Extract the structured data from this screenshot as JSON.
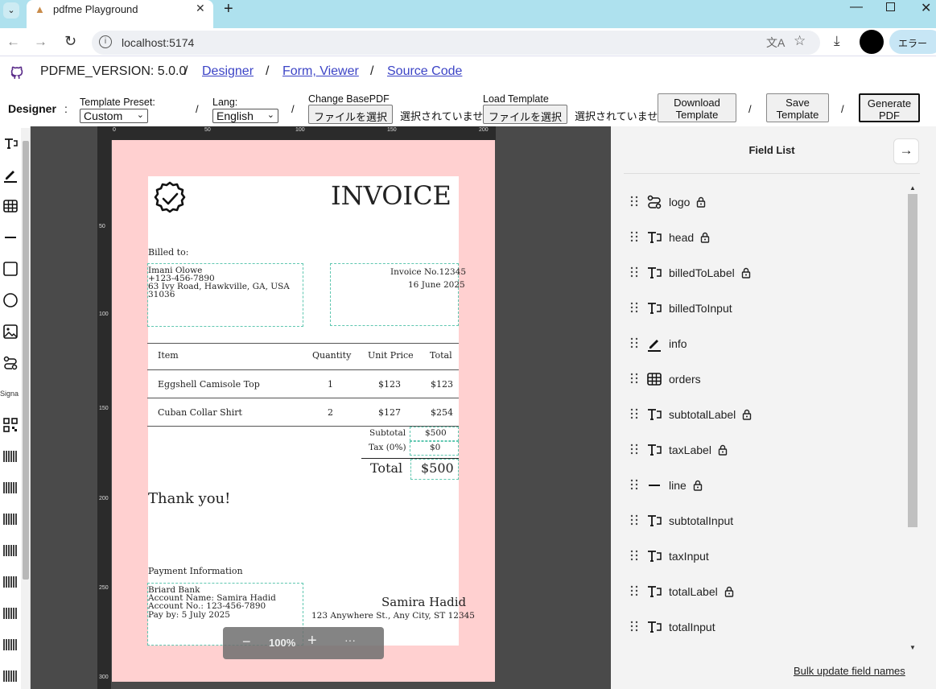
{
  "browser": {
    "tab_title": "pdfme Playground",
    "url": "localhost:5174",
    "error_label": "エラー"
  },
  "header": {
    "version": "PDFME_VERSION: 5.0.0",
    "links": [
      "Designer",
      "Form, Viewer",
      "Source Code"
    ],
    "separator": "/"
  },
  "toolbar": {
    "mode": "Designer",
    "colon": ":",
    "template_preset_label": "Template Preset:",
    "template_preset_value": "Custom",
    "lang_label": "Lang:",
    "lang_value": "English",
    "change_basepdf_label": "Change BasePDF",
    "load_template_label": "Load Template",
    "file_button": "ファイルを選択",
    "file_none": "選択されていません",
    "download_label": "Download Template",
    "save_label": "Save Template",
    "generate_label": "Generate PDF",
    "sep": "/"
  },
  "palette": {
    "signature_label": "Signa"
  },
  "ruler": {
    "top": [
      "0",
      "50",
      "100",
      "150",
      "200"
    ],
    "left": [
      "50",
      "100",
      "150",
      "200",
      "250",
      "300"
    ]
  },
  "invoice": {
    "title": "INVOICE",
    "billed_to_label": "Billed to:",
    "billed_to": [
      "Imani Olowe",
      "+123-456-7890",
      "63 Ivy Road, Hawkville, GA, USA",
      "31036"
    ],
    "info": [
      "Invoice No.12345",
      "16 June 2025"
    ],
    "orders_header": [
      "Item",
      "Quantity",
      "Unit Price",
      "Total"
    ],
    "orders": [
      [
        "Eggshell Camisole Top",
        "1",
        "$123",
        "$123"
      ],
      [
        "Cuban Collar Shirt",
        "2",
        "$127",
        "$254"
      ]
    ],
    "subtotal_label": "Subtotal",
    "subtotal": "$500",
    "tax_label": "Tax (0%)",
    "tax": "$0",
    "total_label": "Total",
    "total": "$500",
    "thank_you": "Thank you!",
    "payment_label": "Payment Information",
    "payment": [
      "Briard Bank",
      "Account Name: Samira Hadid",
      "Account No.: 123-456-7890",
      "Pay by: 5 July 2025"
    ],
    "shop_name": "Samira Hadid",
    "shop_address": "123 Anywhere St., Any City, ST 12345"
  },
  "zoom": {
    "minus": "−",
    "value": "100%",
    "plus": "+",
    "more": "···"
  },
  "field_list": {
    "title": "Field List",
    "items": [
      {
        "name": "logo",
        "icon": "image-icon",
        "locked": true
      },
      {
        "name": "head",
        "icon": "text-icon",
        "locked": true
      },
      {
        "name": "billedToLabel",
        "icon": "text-icon",
        "locked": true
      },
      {
        "name": "billedToInput",
        "icon": "text-icon",
        "locked": false
      },
      {
        "name": "info",
        "icon": "pen-icon",
        "locked": false
      },
      {
        "name": "orders",
        "icon": "table-icon",
        "locked": false
      },
      {
        "name": "subtotalLabel",
        "icon": "text-icon",
        "locked": true
      },
      {
        "name": "taxLabel",
        "icon": "text-icon",
        "locked": true
      },
      {
        "name": "line",
        "icon": "line-icon",
        "locked": true
      },
      {
        "name": "subtotalInput",
        "icon": "text-icon",
        "locked": false
      },
      {
        "name": "taxInput",
        "icon": "text-icon",
        "locked": false
      },
      {
        "name": "totalLabel",
        "icon": "text-icon",
        "locked": true
      },
      {
        "name": "totalInput",
        "icon": "text-icon",
        "locked": false
      }
    ],
    "bulk_update": "Bulk update field names"
  },
  "colors": {
    "link": "#3c44c6",
    "padding_overlay": "#ffb3b3",
    "field_border": "#5fc7b0",
    "canvas_bg": "#4a4a4a"
  }
}
